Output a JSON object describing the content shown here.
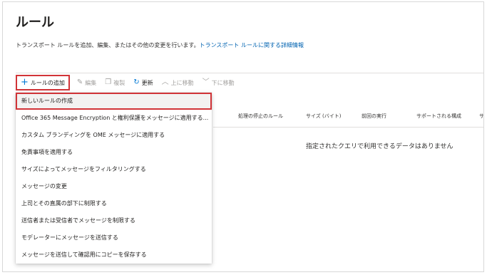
{
  "page": {
    "title": "ルール",
    "description": "トランスポート ルールを追加、編集、またはその他の変更を行います。",
    "description_link": "トランスポート ルールに関する詳細情報"
  },
  "toolbar": {
    "add": "ルールの追加",
    "edit": "編集",
    "copy": "複製",
    "refresh": "更新",
    "move_up": "上に移動",
    "move_down": "下に移動"
  },
  "table": {
    "columns": [
      "処理の停止のルール",
      "サイズ (バイト)",
      "前回の実行",
      "サポートされる構成",
      "サ"
    ],
    "empty_message": "指定されたクエリで利用できるデータはありません"
  },
  "menu": {
    "items": [
      "新しいルールの作成",
      "Office 365 Message Encryption と権利保護をメッセージに適用する...",
      "カスタム ブランディングを OME メッセージに適用する",
      "免責事項を適用する",
      "サイズによってメッセージをフィルタリングする",
      "メッセージの変更",
      "上司とその直属の部下に制限する",
      "送信者または受信者でメッセージを制限する",
      "モデレーターにメッセージを送信する",
      "メッセージを送信して確認用にコピーを保存する"
    ]
  },
  "colors": {
    "accent": "#0078d4",
    "link": "#0063b1",
    "highlight_border": "#d13438"
  }
}
